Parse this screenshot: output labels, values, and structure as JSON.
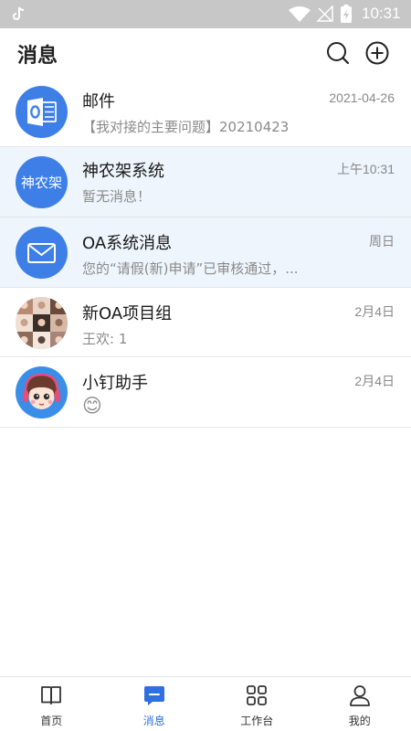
{
  "status_bar": {
    "time": "10:31"
  },
  "header": {
    "title": "消息"
  },
  "conversations": [
    {
      "name": "邮件",
      "time": "2021-04-26",
      "preview": "【我对接的主要问题】20210423",
      "avatar_text": ""
    },
    {
      "name": "神农架系统",
      "time": "上午10:31",
      "preview": "暂无消息！",
      "avatar_text": "神农架"
    },
    {
      "name": "OA系统消息",
      "time": "周日",
      "preview": "您的“请假(新)申请”已审核通过，...",
      "avatar_text": ""
    },
    {
      "name": "新OA项目组",
      "time": "2月4日",
      "preview": "王欢: 1",
      "avatar_text": ""
    },
    {
      "name": "小钉助手",
      "time": "2月4日",
      "preview": "😊",
      "avatar_text": ""
    }
  ],
  "tabs": [
    {
      "label": "首页"
    },
    {
      "label": "消息"
    },
    {
      "label": "工作台"
    },
    {
      "label": "我的"
    }
  ],
  "colors": {
    "accent": "#2f6fdf",
    "avatar_blue": "#3d7fe6",
    "highlight_row": "#eef5fc"
  }
}
